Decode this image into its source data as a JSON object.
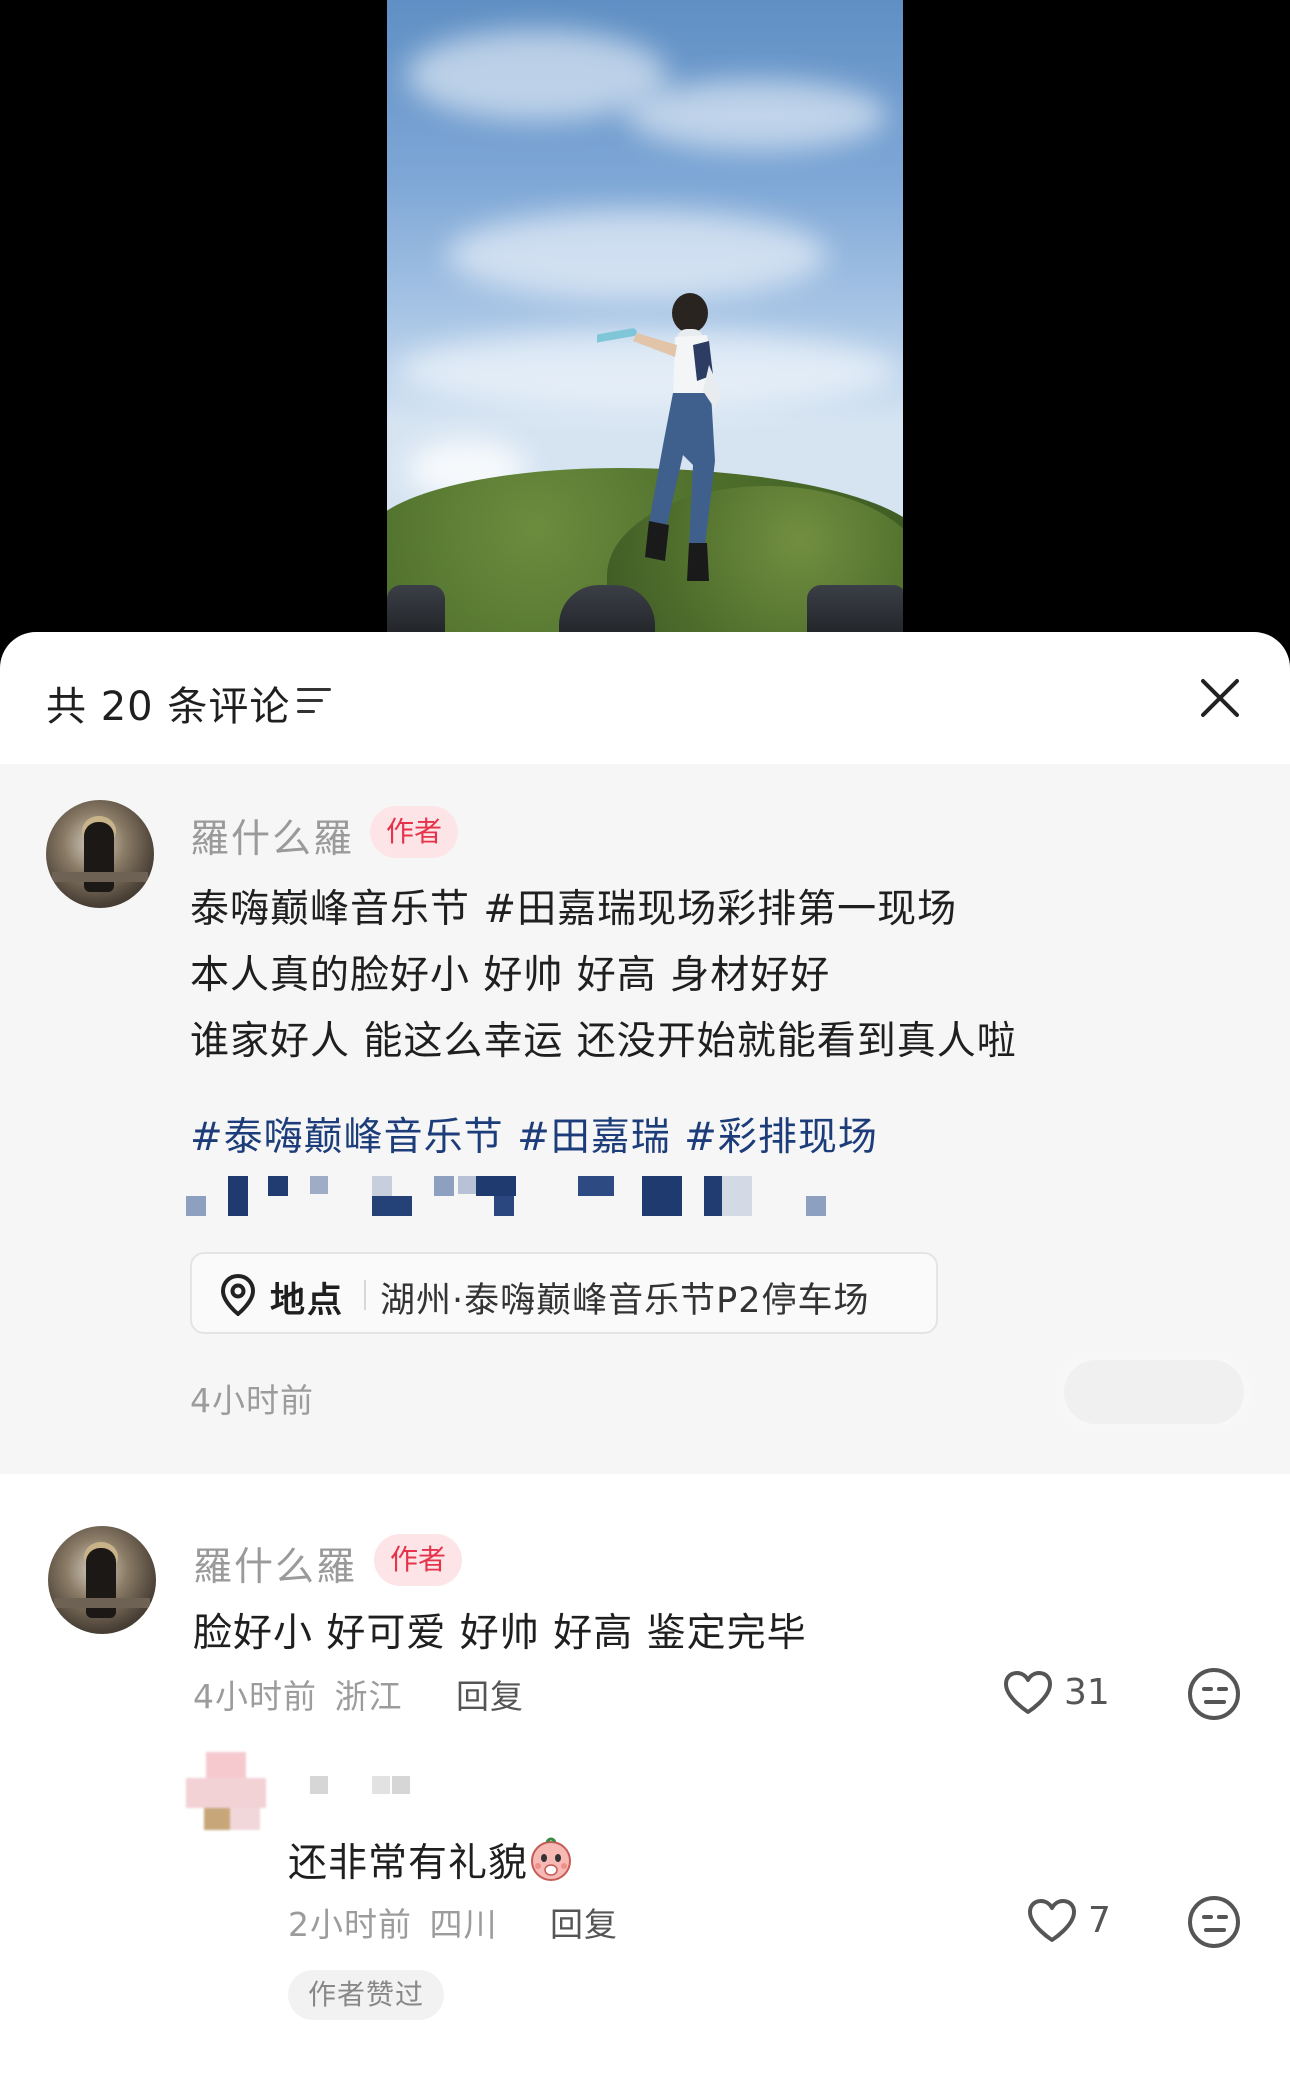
{
  "header": {
    "title": "共 20 条评论"
  },
  "pinned_post": {
    "author_name": "羅什么羅",
    "author_tag": "作者",
    "lines": [
      "泰嗨巅峰音乐节 #田嘉瑞现场彩排第一现场",
      "本人真的脸好小 好帅 好高 身材好好",
      "谁家好人 能这么幸运 还没开始就能看到真人啦"
    ],
    "hashtags": "#泰嗨巅峰音乐节 #田嘉瑞 #彩排现场",
    "location_label": "地点",
    "location_value": "湖州·泰嗨巅峰音乐节P2停车场",
    "time": "4小时前"
  },
  "comments": [
    {
      "author_name": "羅什么羅",
      "author_tag": "作者",
      "text": "脸好小 好可爱 好帅 好高 鉴定完毕",
      "time": "4小时前",
      "region": "浙江",
      "reply_label": "回复",
      "likes": "31"
    }
  ],
  "reply": {
    "text": "还非常有礼貌",
    "time": "2小时前",
    "region": "四川",
    "reply_label": "回复",
    "likes": "7",
    "badge": "作者赞过"
  },
  "colors": {
    "accent_red": "#e5334b",
    "hashtag_blue": "#1d3d7a",
    "post_bg": "#f6f6f6"
  }
}
